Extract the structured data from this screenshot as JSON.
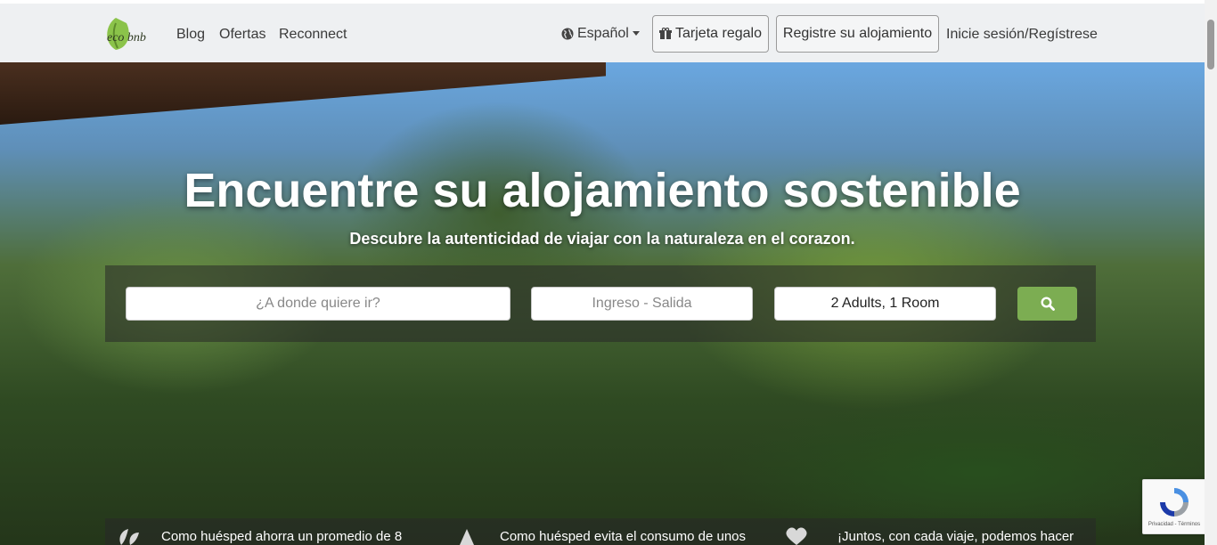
{
  "nav": {
    "logo_text": "eco bnb",
    "links": [
      "Blog",
      "Ofertas",
      "Reconnect"
    ],
    "language": "Español",
    "gift_card": "Tarjeta regalo",
    "register": "Registre su alojamiento",
    "login": "Inicie sesión/Regístrese"
  },
  "hero": {
    "title": "Encuentre su alojamiento sostenible",
    "subtitle": "Descubre la autenticidad de viajar con la naturaleza en el corazon."
  },
  "search": {
    "destination_placeholder": "¿A donde quiere ir?",
    "dates_placeholder": "Ingreso - Salida",
    "guests": "2 Adults, 1 Room"
  },
  "info": [
    "Como huésped ahorra un promedio de 8",
    "Como huésped evita el consumo de unos",
    "¡Juntos, con cada viaje, podemos hacer"
  ],
  "recaptcha_text": "Privacidad - Términos",
  "colors": {
    "accent_green": "#7cad52",
    "navbar_bg": "#eef0f2"
  }
}
